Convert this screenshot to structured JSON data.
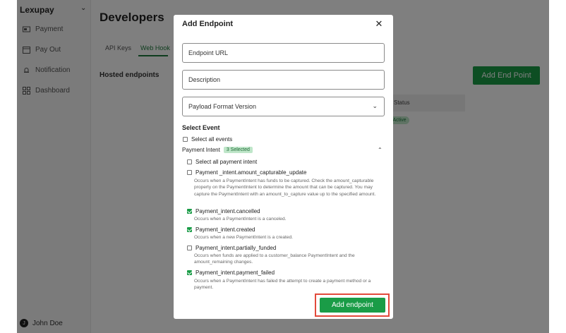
{
  "sidebar": {
    "brand": "Lexupay",
    "items": [
      {
        "label": "Payment",
        "icon": "payment-icon"
      },
      {
        "label": "Pay Out",
        "icon": "calendar-icon"
      },
      {
        "label": "Notification",
        "icon": "bell-icon"
      },
      {
        "label": "Dashboard",
        "icon": "dashboard-icon"
      }
    ],
    "user": {
      "name": "John Doe",
      "initial": "J"
    }
  },
  "main": {
    "title": "Developers",
    "tabs": [
      {
        "label": "API Keys"
      },
      {
        "label": "Web Hook"
      }
    ],
    "section_title": "Hosted endpoints",
    "add_button": "Add End Point",
    "table_header": "Status",
    "status_pill": "Active"
  },
  "modal": {
    "title": "Add Endpoint",
    "url_placeholder": "Endpoint URL",
    "description_placeholder": "Description",
    "payload_format": "Payload Format Version",
    "select_event_label": "Select Event",
    "select_all_events": "Select all events",
    "group": {
      "name": "Payment Intent",
      "badge": "3 Selected"
    },
    "select_all_group": "Select all payment intent",
    "events": [
      {
        "name": "Payment _intent.amount_capturable_update",
        "checked": false,
        "desc": "Occurs when a PaymentIntent has funds to be captured. Check the amount_capturable property on the PaymentIntent to determine the amount that can be captured. You may capture the PaymentIntent with an amount_to_capture value up to the specified amount."
      },
      {
        "name": "Payment_intent.cancelled",
        "checked": true,
        "desc": "Occurs when a PaymentIntent is a canceled."
      },
      {
        "name": "Payment_intent.created",
        "checked": true,
        "desc": "Occurs when a new PaymentIntent is a created."
      },
      {
        "name": "Payment_intent.partially_funded",
        "checked": false,
        "desc": "Occurs when funds are applied to a customer_balance PaymentIntent and the amount_remaining changes."
      },
      {
        "name": "Payment_intent.payment_failed",
        "checked": true,
        "desc": "Occurs when a PaymentIntent has failed the attempt to create a payment method or a payment."
      }
    ],
    "submit_label": "Add endpoint"
  },
  "colors": {
    "accent": "#1a9c47",
    "highlight": "#e24a3b"
  }
}
